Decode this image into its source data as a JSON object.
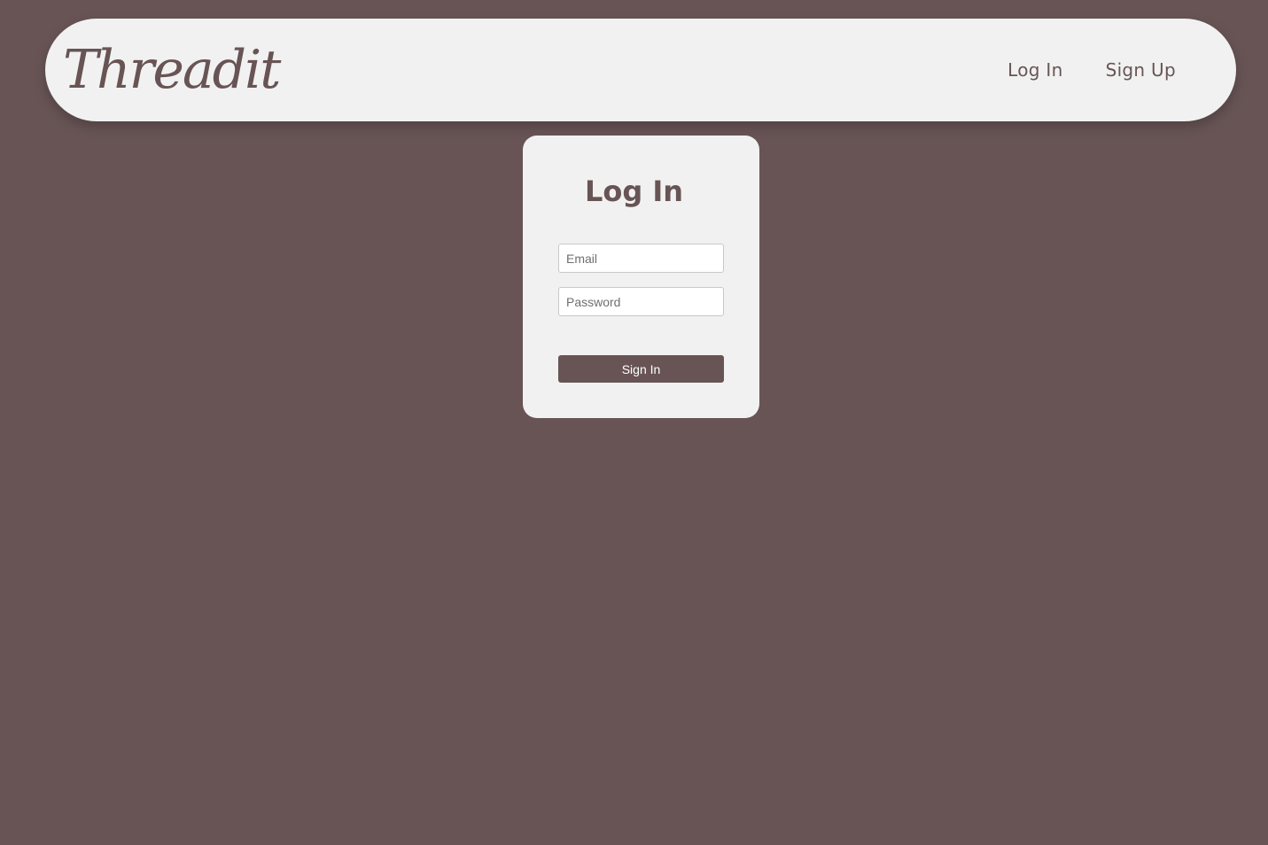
{
  "brand": {
    "logo_text": "Threadit"
  },
  "nav": {
    "links": [
      {
        "label": "Log In"
      },
      {
        "label": "Sign Up"
      }
    ]
  },
  "login_form": {
    "title": "Log In",
    "email": {
      "value": "",
      "placeholder": "Email"
    },
    "password": {
      "value": "",
      "placeholder": "Password"
    },
    "submit_label": "Sign In"
  },
  "colors": {
    "background": "#685455",
    "surface": "#f1f1f1",
    "accent": "#685455",
    "button_text": "#ffffff"
  }
}
